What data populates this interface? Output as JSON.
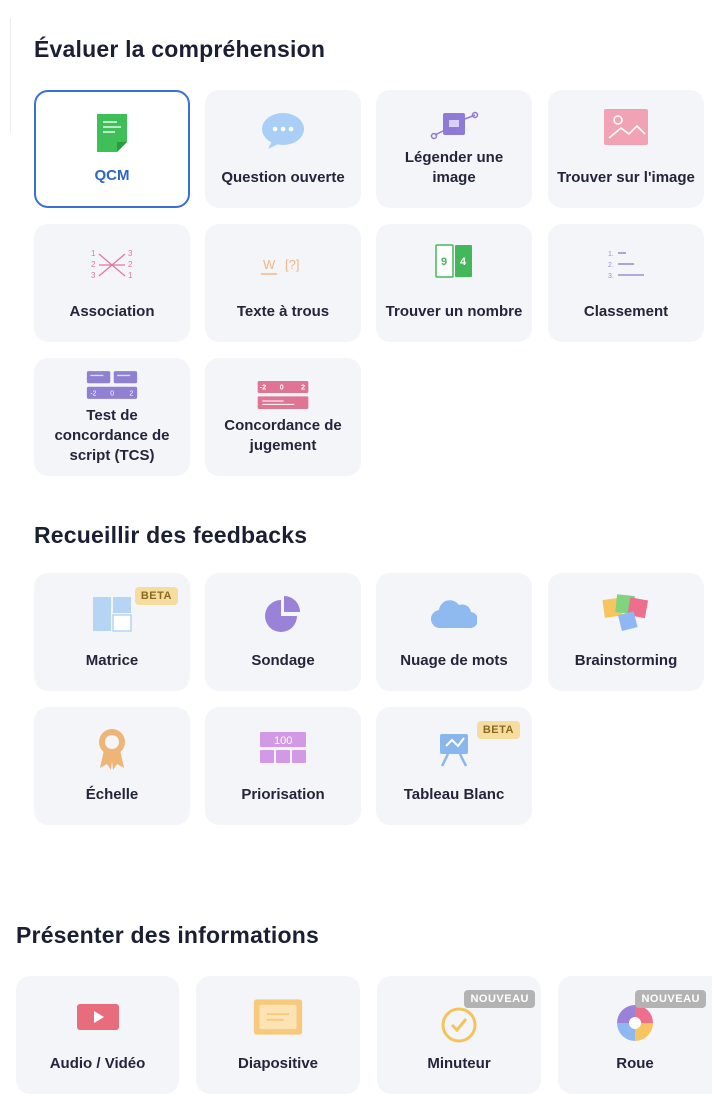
{
  "sections": {
    "evaluate": {
      "title": "Évaluer la compréhension",
      "items": [
        {
          "label": "QCM",
          "icon": "qcm-icon",
          "selected": true
        },
        {
          "label": "Question ouverte",
          "icon": "speech-bubble-icon"
        },
        {
          "label": "Légender une image",
          "icon": "caption-image-icon"
        },
        {
          "label": "Trouver sur l'image",
          "icon": "landscape-image-icon"
        },
        {
          "label": "Association",
          "icon": "association-icon"
        },
        {
          "label": "Texte à trous",
          "icon": "fill-blanks-icon"
        },
        {
          "label": "Trouver un nombre",
          "icon": "number-icon"
        },
        {
          "label": "Classement",
          "icon": "ranking-list-icon"
        },
        {
          "label": "Test de concordance de script (TCS)",
          "icon": "tcs-icon"
        },
        {
          "label": "Concordance de jugement",
          "icon": "judgment-concordance-icon"
        }
      ]
    },
    "feedback": {
      "title": "Recueillir des feedbacks",
      "items": [
        {
          "label": "Matrice",
          "icon": "matrix-icon",
          "badge": "BETA"
        },
        {
          "label": "Sondage",
          "icon": "pie-chart-icon"
        },
        {
          "label": "Nuage de mots",
          "icon": "cloud-icon"
        },
        {
          "label": "Brainstorming",
          "icon": "sticky-notes-icon"
        },
        {
          "label": "Échelle",
          "icon": "award-ribbon-icon"
        },
        {
          "label": "Priorisation",
          "icon": "priority-100-icon"
        },
        {
          "label": "Tableau Blanc",
          "icon": "whiteboard-icon",
          "badge": "BETA"
        }
      ]
    },
    "present": {
      "title": "Présenter des informations",
      "items": [
        {
          "label": "Audio / Vidéo",
          "icon": "play-video-icon"
        },
        {
          "label": "Diapositive",
          "icon": "slide-icon"
        },
        {
          "label": "Minuteur",
          "icon": "timer-icon",
          "badge": "NOUVEAU"
        },
        {
          "label": "Roue",
          "icon": "wheel-icon",
          "badge": "NOUVEAU"
        }
      ]
    }
  },
  "numbers": {
    "assoc_left": [
      "1",
      "2",
      "3"
    ],
    "assoc_right": [
      "3",
      "2",
      "1"
    ],
    "blank_word": "W",
    "blank_mark": "[?]",
    "find_number": [
      "9",
      "4"
    ],
    "ranking": [
      "1.",
      "2.",
      "3."
    ],
    "tcs_scale": [
      "-2",
      "0",
      "2"
    ],
    "judgment_scale": [
      "-2",
      "0",
      "2"
    ],
    "priority_value": "100"
  },
  "colors": {
    "accent": "#3b6fd8",
    "card_bg": "#f4f5f9",
    "beta_bg": "#f6dc9f",
    "nouveau_bg": "#b3b3b3"
  }
}
